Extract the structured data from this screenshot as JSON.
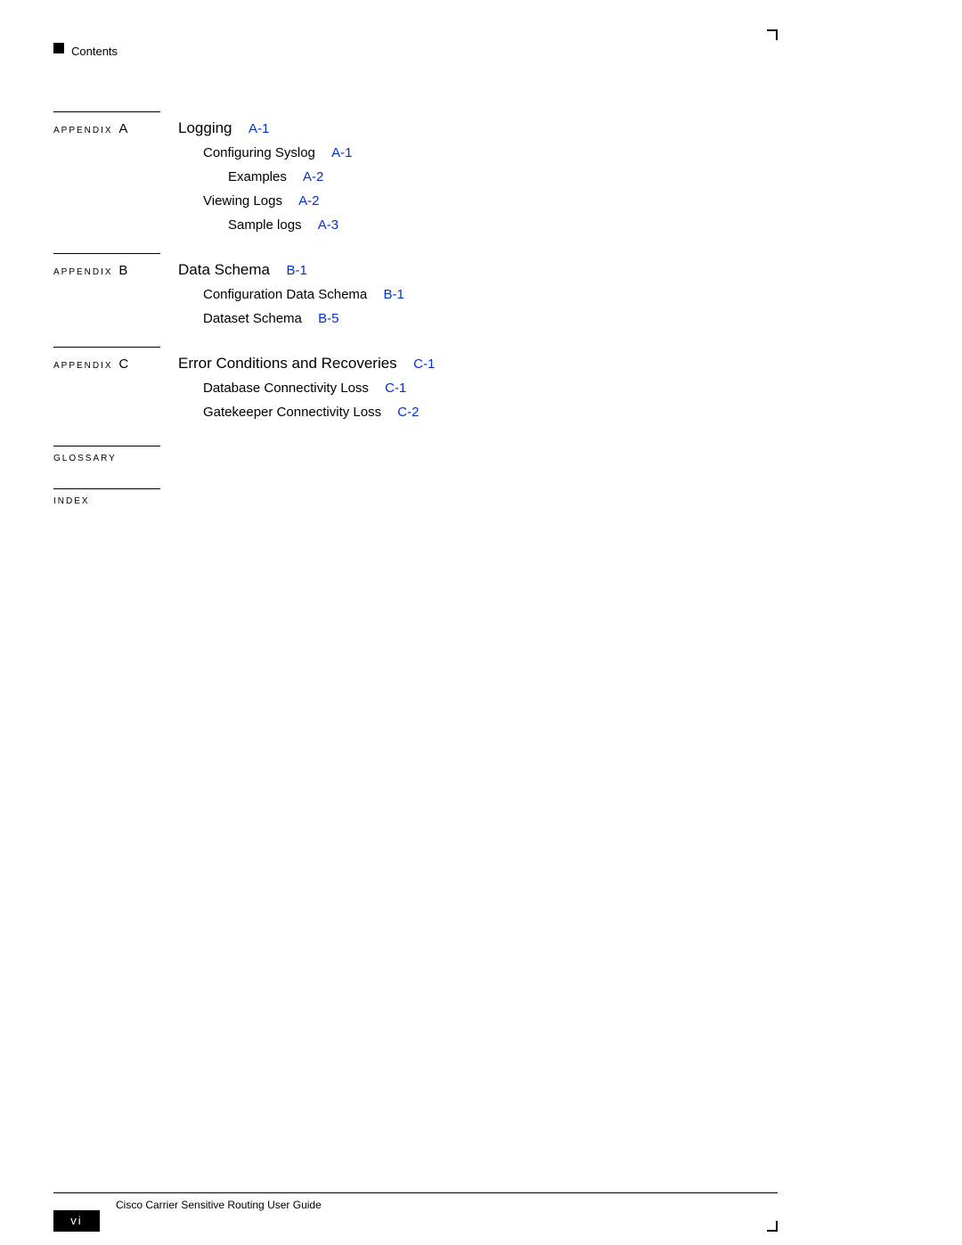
{
  "header": {
    "label": "Contents"
  },
  "sections": [
    {
      "prefix": "APPENDIX",
      "letter": "A",
      "title": "Logging",
      "page": "A-1",
      "items": [
        {
          "text": "Configuring Syslog",
          "page": "A-1",
          "indent": 0
        },
        {
          "text": "Examples",
          "page": "A-2",
          "indent": 1
        },
        {
          "text": "Viewing Logs",
          "page": "A-2",
          "indent": 0
        },
        {
          "text": "Sample logs",
          "page": "A-3",
          "indent": 1
        }
      ]
    },
    {
      "prefix": "APPENDIX",
      "letter": "B",
      "title": "Data Schema",
      "page": "B-1",
      "items": [
        {
          "text": "Configuration Data Schema",
          "page": "B-1",
          "indent": 0
        },
        {
          "text": "Dataset Schema",
          "page": "B-5",
          "indent": 0
        }
      ]
    },
    {
      "prefix": "APPENDIX",
      "letter": "C",
      "title": "Error Conditions and Recoveries",
      "page": "C-1",
      "items": [
        {
          "text": "Database Connectivity Loss",
          "page": "C-1",
          "indent": 0
        },
        {
          "text": "Gatekeeper Connectivity Loss",
          "page": "C-2",
          "indent": 0
        }
      ]
    }
  ],
  "simple_sections": [
    {
      "label": "GLOSSARY"
    },
    {
      "label": "INDEX"
    }
  ],
  "footer": {
    "book_title": "Cisco Carrier Sensitive Routing User Guide",
    "page_number": "vi"
  }
}
